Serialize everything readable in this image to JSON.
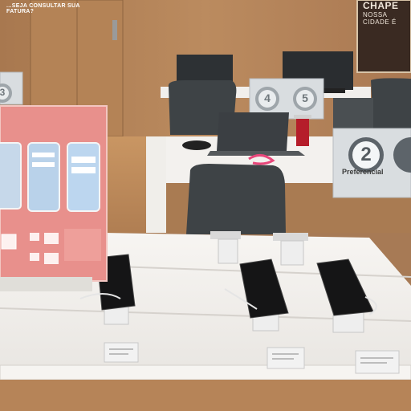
{
  "scene": {
    "description_colors": {
      "wood": "#b68458",
      "counter": "#f4f2ef",
      "sign_pink": "#e8908c",
      "chair": "#3e4346",
      "number_sign": "#d9dde0"
    }
  },
  "promo_sign": {
    "headline": "...SEJA CONSULTAR SUA FATURA?",
    "steps": [
      "",
      "",
      ""
    ]
  },
  "priority_sign": {
    "number": "2",
    "label": "Preferencial"
  },
  "desk_signs": [
    {
      "number": "4"
    },
    {
      "number": "5"
    }
  ],
  "wall_banner": {
    "line1": "CHAPE",
    "line2": "NOSSA CIDADE É"
  },
  "left_sign": {
    "number": "3"
  }
}
